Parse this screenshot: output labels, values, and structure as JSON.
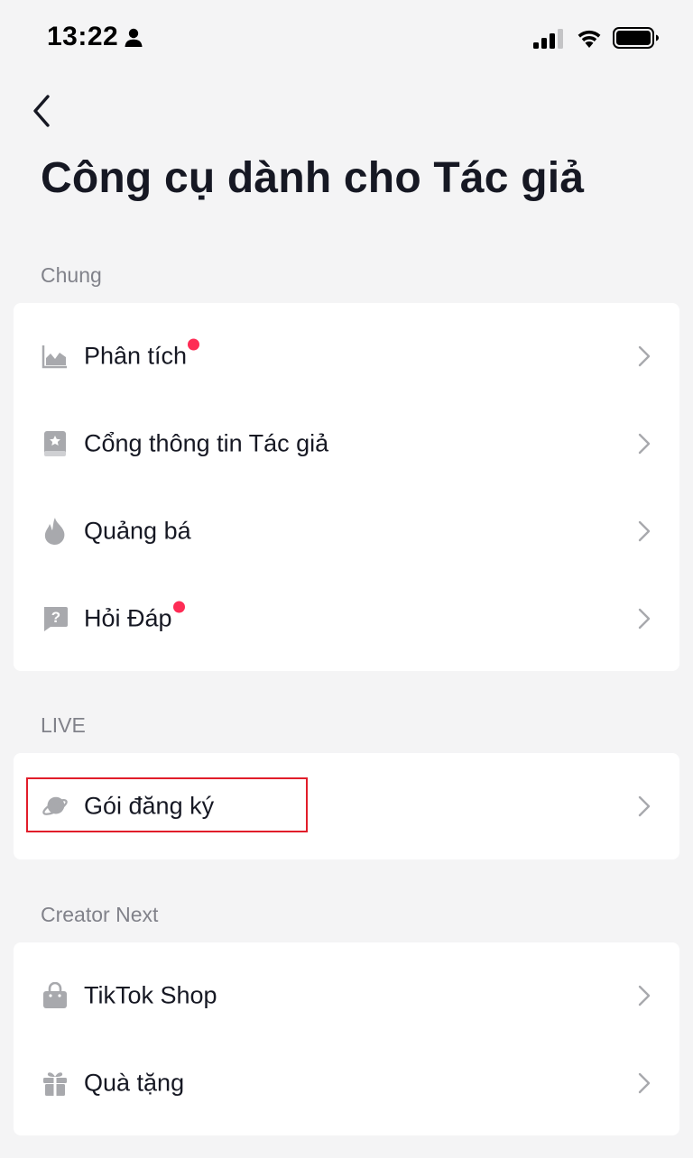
{
  "status_bar": {
    "time": "13:22",
    "icons": [
      "person-icon",
      "signal-icon",
      "wifi-icon",
      "battery-icon"
    ]
  },
  "header": {
    "back_icon": "chevron-left-icon",
    "title": "Công cụ dành cho Tác giả"
  },
  "sections": {
    "general": {
      "label": "Chung",
      "items": [
        {
          "label": "Phân tích",
          "icon": "analytics-icon",
          "badge": true
        },
        {
          "label": "Cổng thông tin Tác giả",
          "icon": "creator-portal-icon",
          "badge": false
        },
        {
          "label": "Quảng bá",
          "icon": "flame-icon",
          "badge": false
        },
        {
          "label": "Hỏi Đáp",
          "icon": "question-icon",
          "badge": true
        }
      ]
    },
    "live": {
      "label": "LIVE",
      "items": [
        {
          "label": "Gói đăng ký",
          "icon": "subscription-planet-icon",
          "badge": false,
          "highlighted": true
        }
      ]
    },
    "creator_next": {
      "label": "Creator Next",
      "items": [
        {
          "label": "TikTok Shop",
          "icon": "shopping-bag-icon",
          "badge": false
        },
        {
          "label": "Quà tặng",
          "icon": "gift-icon",
          "badge": false
        }
      ]
    }
  },
  "colors": {
    "background": "#f4f4f5",
    "card": "#ffffff",
    "badge": "#fe2c55",
    "highlight_border": "#e11d2a",
    "icon_gray": "#a8a9ad",
    "section_label": "#81828a"
  }
}
